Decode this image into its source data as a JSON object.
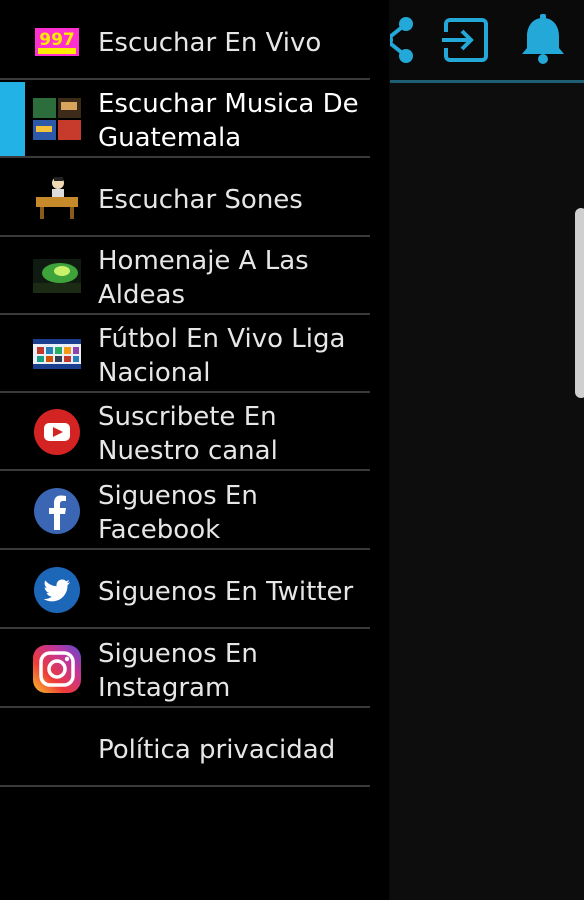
{
  "toolbar": {
    "icons": [
      "share-icon",
      "exit-to-app-icon",
      "bell-icon"
    ],
    "accent_color": "#1f5f73"
  },
  "drawer": {
    "active_color": "#23b2e6",
    "items": [
      {
        "label": "Escuchar En Vivo",
        "icon": "station-997-logo-icon",
        "active": false
      },
      {
        "label": "Escuchar Musica De Guatemala",
        "icon": "guatemala-music-thumbnail-icon",
        "active": true
      },
      {
        "label": "Escuchar Sones",
        "icon": "marimba-player-icon",
        "active": false
      },
      {
        "label": "Homenaje A Las Aldeas",
        "icon": "village-night-icon",
        "active": false
      },
      {
        "label": "Fútbol En Vivo Liga Nacional",
        "icon": "football-league-icon",
        "active": false
      },
      {
        "label": "Suscribete En Nuestro canal",
        "icon": "youtube-icon",
        "active": false
      },
      {
        "label": "Siguenos En Facebook",
        "icon": "facebook-icon",
        "active": false
      },
      {
        "label": "Siguenos En Twitter",
        "icon": "twitter-icon",
        "active": false
      },
      {
        "label": "Siguenos En Instagram",
        "icon": "instagram-icon",
        "active": false
      },
      {
        "label": "Política privacidad",
        "icon": "",
        "active": false
      }
    ]
  }
}
